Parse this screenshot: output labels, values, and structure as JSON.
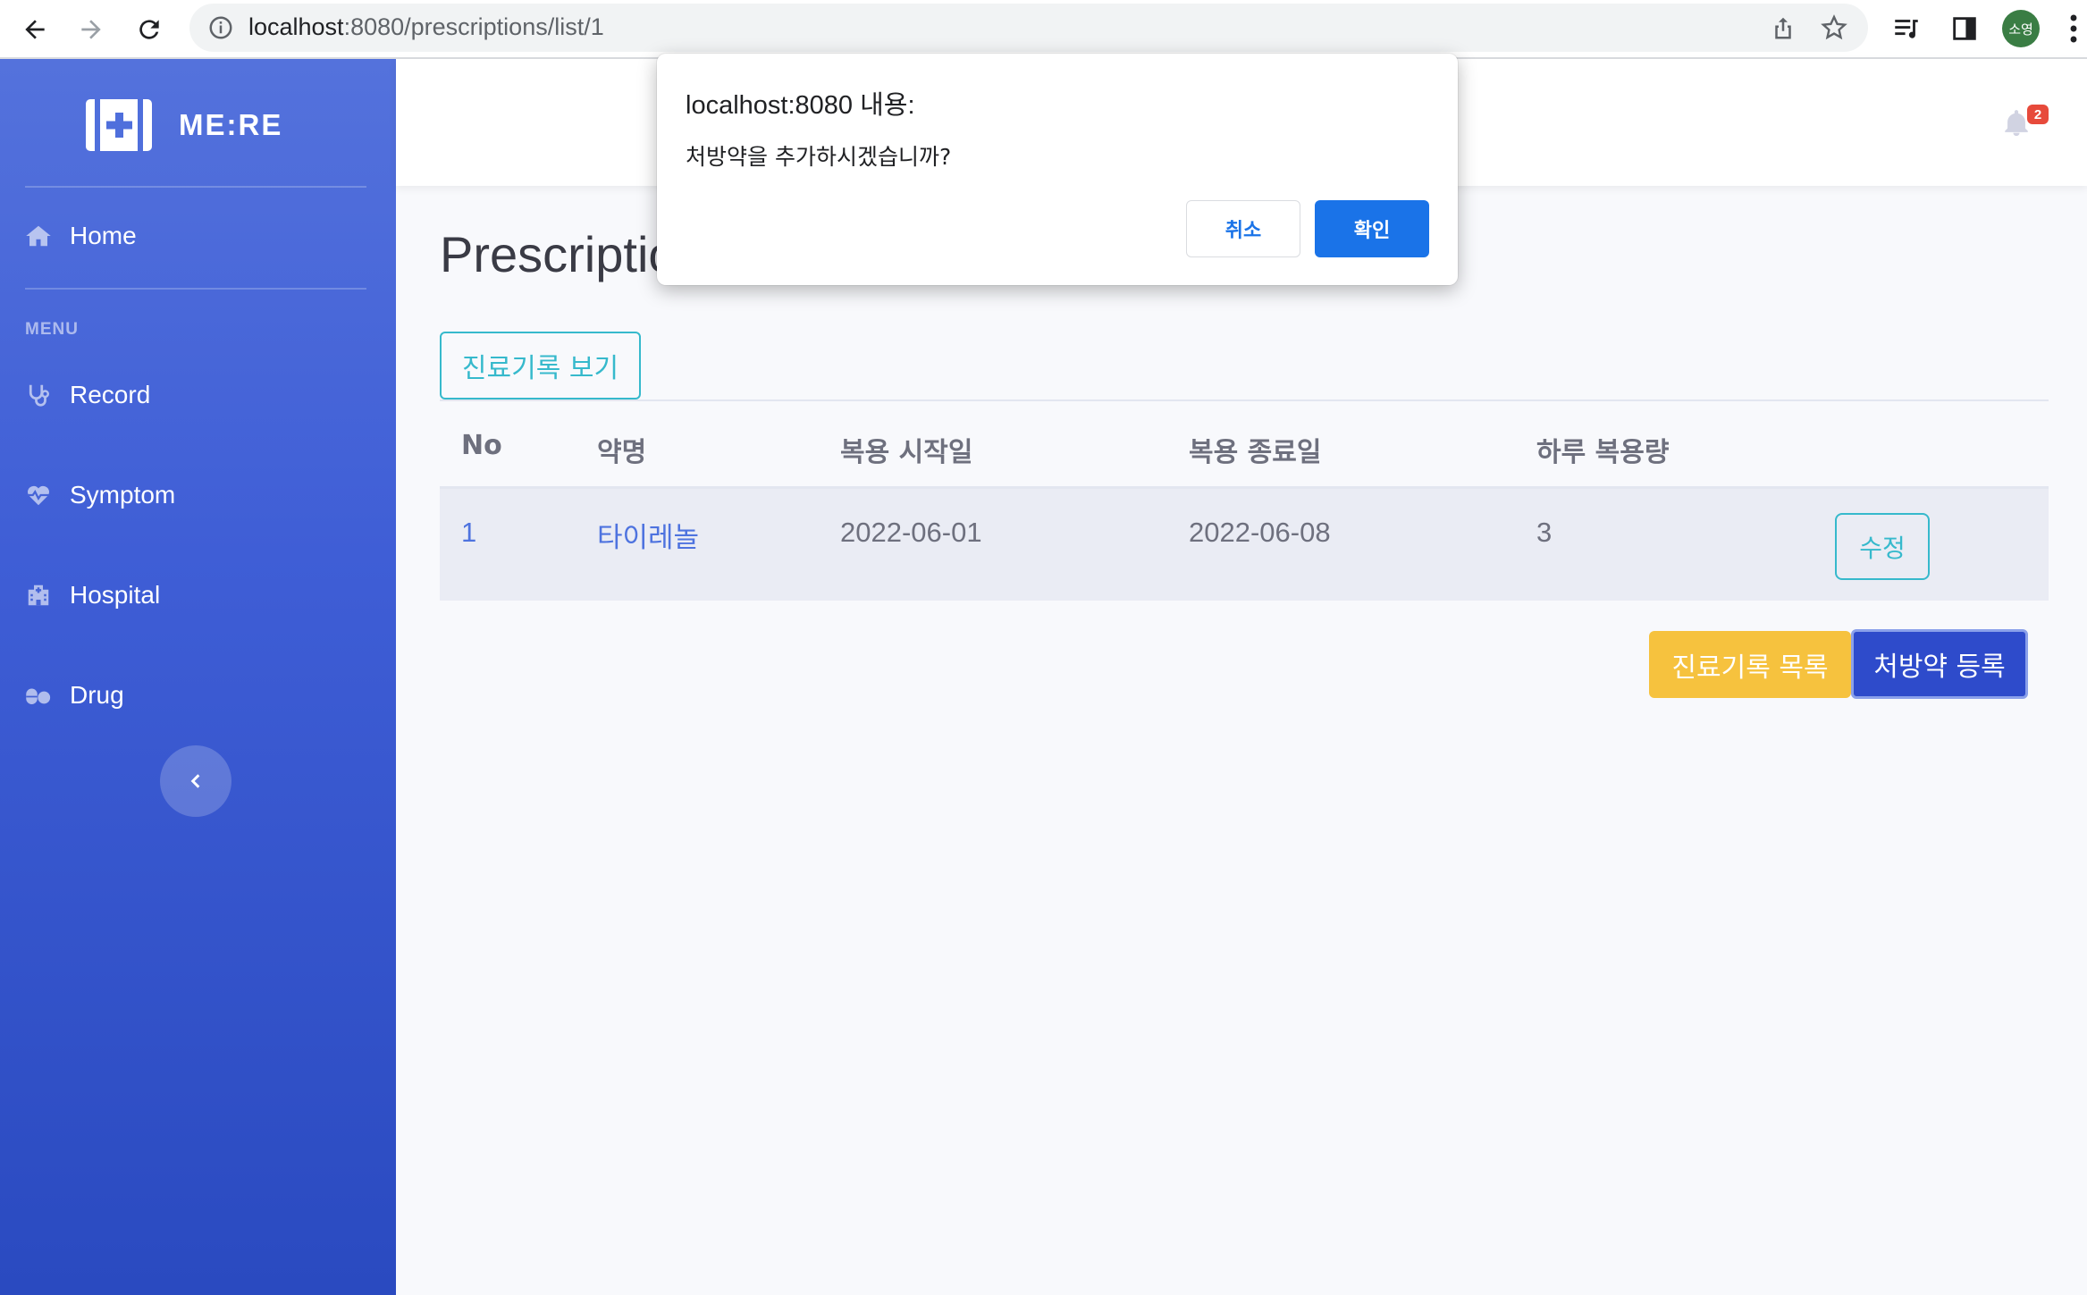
{
  "browser": {
    "url_host": "localhost",
    "url_path": ":8080/prescriptions/list/1",
    "profile_initials": "소영"
  },
  "sidebar": {
    "brand": "ME:RE",
    "home_label": "Home",
    "menu_heading": "MENU",
    "items": [
      {
        "label": "Record",
        "icon": "stethoscope-icon"
      },
      {
        "label": "Symptom",
        "icon": "heartbeat-icon"
      },
      {
        "label": "Hospital",
        "icon": "hospital-icon"
      },
      {
        "label": "Drug",
        "icon": "pills-icon"
      }
    ]
  },
  "topbar": {
    "alert_count": "2"
  },
  "main": {
    "title": "Prescriptions",
    "view_records_button": "진료기록 보기",
    "table": {
      "headers": [
        "No",
        "약명",
        "복용 시작일",
        "복용 종료일",
        "하루 복용량"
      ],
      "rows": [
        {
          "no": "1",
          "drug": "타이레놀",
          "start": "2022-06-01",
          "end": "2022-06-08",
          "daily_dose": "3",
          "edit_label": "수정"
        }
      ]
    },
    "list_records_button": "진료기록 목록",
    "register_button": "처방약 등록"
  },
  "dialog": {
    "title": "localhost:8080 내용:",
    "message": "처방약을 추가하시겠습니까?",
    "cancel_label": "취소",
    "ok_label": "확인"
  },
  "colors": {
    "sidebar_top": "#5472dc",
    "sidebar_bottom": "#2a4ac0",
    "info": "#36b9cc",
    "warning": "#f6c23e",
    "primary": "#2e4bcb",
    "dialog_button": "#1a73e8",
    "badge": "#e74a3b"
  }
}
